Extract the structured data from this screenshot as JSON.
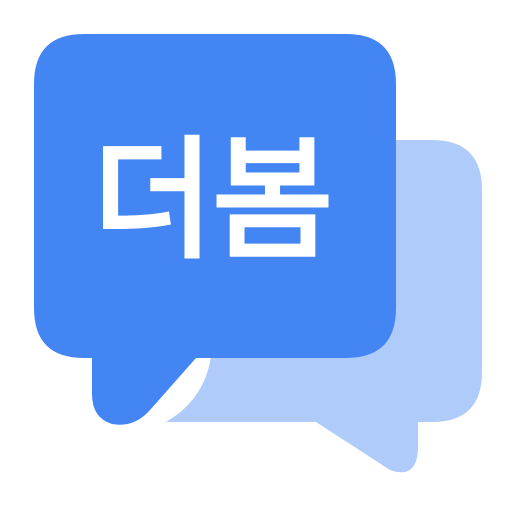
{
  "app_icon": {
    "text": "더봄",
    "colors": {
      "primary_bubble": "#4385F3",
      "secondary_bubble": "#AECBFA",
      "text": "#FFFFFF",
      "background": "#FFFFFF"
    },
    "icons": [
      "chat-bubble-primary-icon",
      "chat-bubble-secondary-icon"
    ]
  }
}
